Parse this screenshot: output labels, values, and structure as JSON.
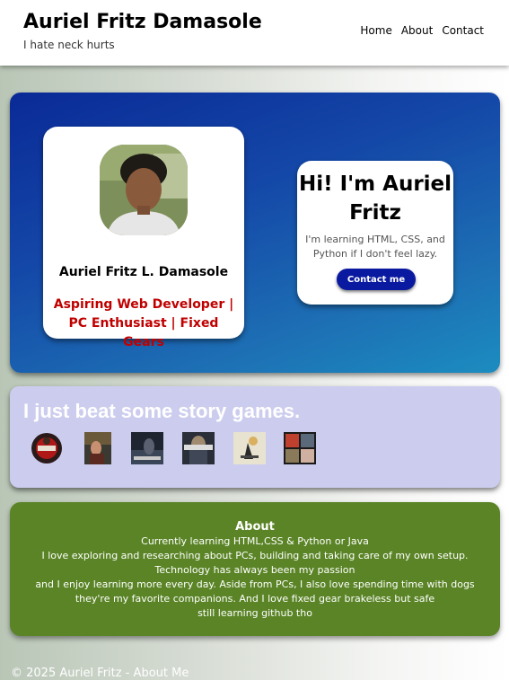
{
  "header": {
    "title": "Auriel Fritz Damasole",
    "tagline": "I hate neck hurts",
    "nav": [
      "Home",
      "About",
      "Contact"
    ]
  },
  "profile": {
    "name": "Auriel Fritz L. Damasole",
    "role": "Aspiring Web Developer | PC Enthusiast | Fixed Gears"
  },
  "greeting": {
    "title": "Hi! I'm Auriel Fritz",
    "text": "I'm learning HTML, CSS, and Python if I don't feel lazy.",
    "button": "Contact me"
  },
  "games": {
    "title": "I just beat some story games.",
    "icons": [
      "red-dead-redemption-icon",
      "the-last-of-us-icon",
      "game-icon-3",
      "game-icon-4",
      "ghost-of-tsushima-icon",
      "gta-icon"
    ]
  },
  "about": {
    "title": "About",
    "lines": [
      "Currently learning HTML,CSS & Python or Java",
      "I love exploring and researching about PCs, building and taking care of my own setup.",
      "Technology has always been my passion",
      "and I enjoy learning more every day. Aside from PCs, I also love spending time with dogs they're my favorite companions. And I love fixed gear brakeless but safe",
      "still learning github tho"
    ]
  },
  "footer": {
    "text": "© 2025 Auriel Fritz - About Me"
  },
  "colors": {
    "hero_gradient_start": "#0a2a96",
    "hero_gradient_end": "#1c8cc0",
    "role_red": "#c00000",
    "button_blue": "#0a1aa0",
    "games_bg": "#cccdee",
    "about_bg": "#5a8426"
  }
}
